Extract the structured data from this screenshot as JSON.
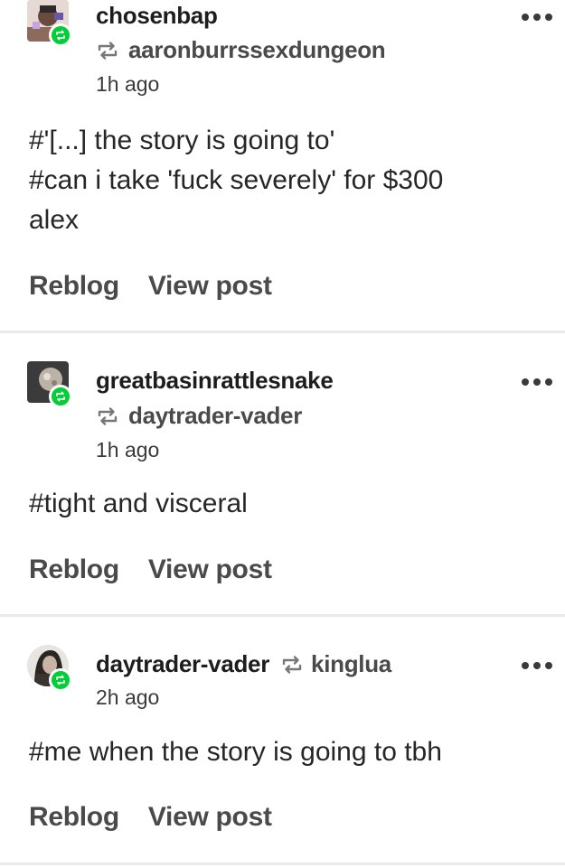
{
  "posts": [
    {
      "username": "chosenbap",
      "reblogged_from": "aaronburrssexdungeon",
      "time": "1h ago",
      "tags": [
        "#'[...] the story is going to'",
        "#can i take 'fuck severely' for $300",
        "alex"
      ],
      "actions": {
        "reblog": "Reblog",
        "view": "View post"
      }
    },
    {
      "username": "greatbasinrattlesnake",
      "reblogged_from": "daytrader-vader",
      "time": "1h ago",
      "tags": [
        "#tight and visceral"
      ],
      "actions": {
        "reblog": "Reblog",
        "view": "View post"
      }
    },
    {
      "username": "daytrader-vader",
      "reblogged_from": "kinglua",
      "time": "2h ago",
      "tags": [
        "#me when the story is going to tbh"
      ],
      "actions": {
        "reblog": "Reblog",
        "view": "View post"
      }
    }
  ],
  "colors": {
    "reblog_badge": "#00cf35",
    "divider": "#e9e9e9",
    "text": "#262626"
  },
  "icons": {
    "reblog": "reblog-icon",
    "more": "more-options-icon"
  }
}
